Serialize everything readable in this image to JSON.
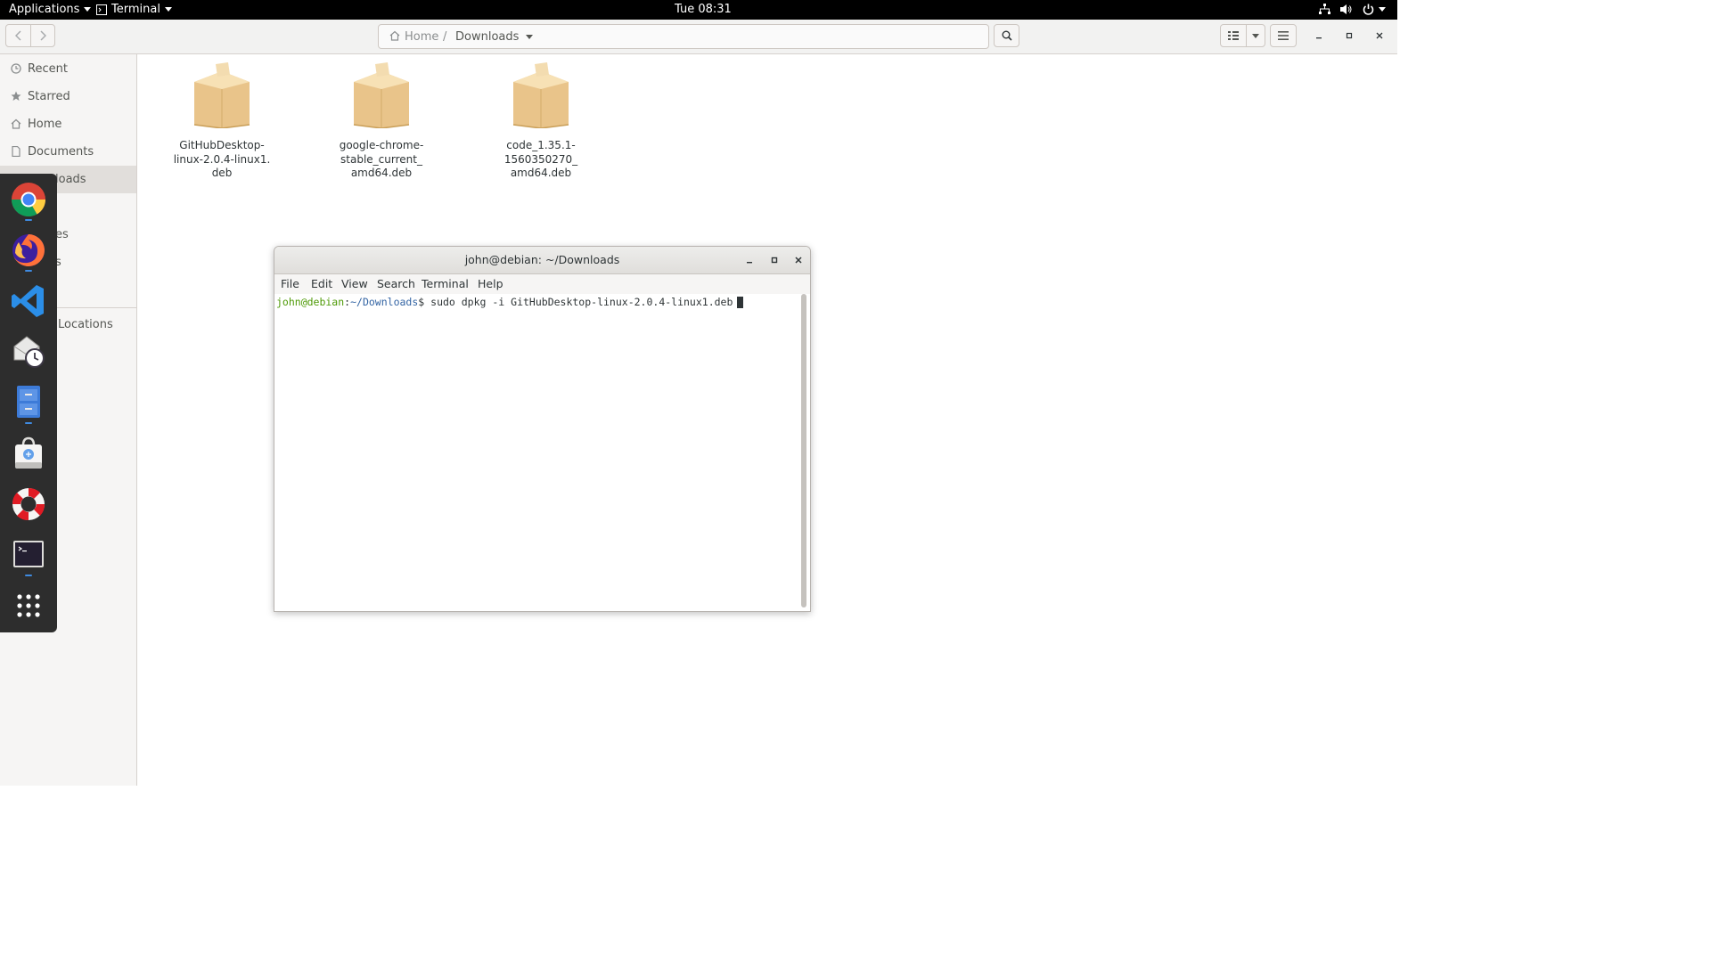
{
  "topbar": {
    "applications_label": "Applications",
    "app_menu_label": "Terminal",
    "clock": "Tue 08:31"
  },
  "headerbar": {
    "path_home": "Home",
    "path_separator": "/",
    "path_current": "Downloads"
  },
  "sidebar": {
    "items": [
      {
        "label": "Recent",
        "icon": "clock-icon"
      },
      {
        "label": "Starred",
        "icon": "star-icon"
      },
      {
        "label": "Home",
        "icon": "home-icon"
      },
      {
        "label": "Documents",
        "icon": "document-icon"
      },
      {
        "label": "loads",
        "icon": "download-icon"
      },
      {
        "label": "es",
        "icon": "picture-icon"
      },
      {
        "label": "s",
        "icon": "video-icon"
      },
      {
        "label": "Locations",
        "icon": "plus-icon"
      }
    ]
  },
  "files": [
    {
      "name_lines": [
        "GitHubDesktop-",
        "linux-2.0.4-linux1.",
        "deb"
      ],
      "icon": "package-icon"
    },
    {
      "name_lines": [
        "google-chrome-",
        "stable_current_",
        "amd64.deb"
      ],
      "icon": "package-icon"
    },
    {
      "name_lines": [
        "code_1.35.1-",
        "1560350270_",
        "amd64.deb"
      ],
      "icon": "package-icon"
    }
  ],
  "dash": {
    "apps": [
      "chrome-icon",
      "firefox-icon",
      "vscode-icon",
      "evolution-icon",
      "file-cabinet-icon",
      "software-store-icon",
      "help-lifebuoy-icon",
      "terminal-icon",
      "app-grid-icon"
    ]
  },
  "terminal": {
    "title": "john@debian: ~/Downloads",
    "menu": [
      "File",
      "Edit",
      "View",
      "Search",
      "Terminal",
      "Help"
    ],
    "prompt_user": "john@debian",
    "prompt_colon": ":",
    "prompt_path": "~/Downloads",
    "prompt_symbol": "$",
    "command": " sudo dpkg -i GitHubDesktop-linux-2.0.4-linux1.deb"
  },
  "colors": {
    "prompt_user": "#4e9a06",
    "prompt_path": "#3465a4",
    "dash_bg": "#2d2d2d",
    "running_indicator": "#3f8ae0"
  }
}
